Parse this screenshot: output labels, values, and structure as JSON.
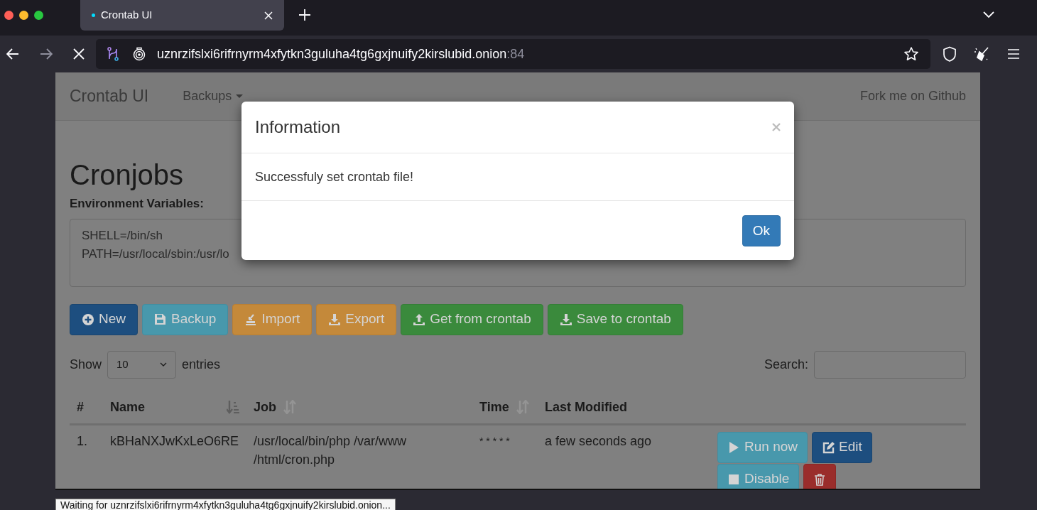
{
  "browser": {
    "tab": {
      "title": "Crontab UI",
      "loading": true
    },
    "url": {
      "host": "uznrzifslxi6rifrnyrm4xfytkn3guluha4tg6gxjnuify2kirslubid.onion",
      "port": ":84"
    },
    "status": "Waiting for uznrzifslxi6rifrnyrm4xfytkn3guluha4tg6gxjnuify2kirslubid.onion..."
  },
  "navbar": {
    "brand": "Crontab UI",
    "menu": [
      {
        "label": "Backups",
        "dropdown": true
      }
    ],
    "right_link": "Fork me on Github"
  },
  "heading": "Cronjobs",
  "env": {
    "label": "Environment Variables:",
    "lines": [
      "SHELL=/bin/sh",
      "PATH=/usr/local/sbin:/usr/lo"
    ]
  },
  "toolbar": [
    {
      "label": "New",
      "kind": "new"
    },
    {
      "label": "Backup",
      "kind": "backup"
    },
    {
      "label": "Import",
      "kind": "import"
    },
    {
      "label": "Export",
      "kind": "export"
    },
    {
      "label": "Get from crontab",
      "kind": "get"
    },
    {
      "label": "Save to crontab",
      "kind": "save"
    }
  ],
  "length": {
    "show": "Show",
    "value": "10",
    "entries": "entries"
  },
  "search": {
    "label": "Search:"
  },
  "table": {
    "columns": [
      {
        "label": "#",
        "kind": "plain"
      },
      {
        "label": "Name",
        "kind": "sorted"
      },
      {
        "label": "Job",
        "kind": "sortable"
      },
      {
        "label": "Time",
        "kind": "sortable"
      },
      {
        "label": "Last Modified",
        "kind": "plain"
      }
    ],
    "rows": [
      {
        "index": "1.",
        "name": "kBHaNXJwKxLeO6RE",
        "job_lines": [
          "/usr/local/bin/php /var/www",
          "/html/cron.php"
        ],
        "time": "* * * * *",
        "last_modified": "a few seconds ago",
        "actions": [
          {
            "label": "Run now",
            "kind": "run"
          },
          {
            "label": "Edit",
            "kind": "edit"
          },
          {
            "label": "Disable",
            "kind": "disable"
          },
          {
            "kind": "delete"
          }
        ]
      }
    ]
  },
  "modal": {
    "title": "Information",
    "message": "Successfuly set crontab file!",
    "ok": "Ok"
  }
}
